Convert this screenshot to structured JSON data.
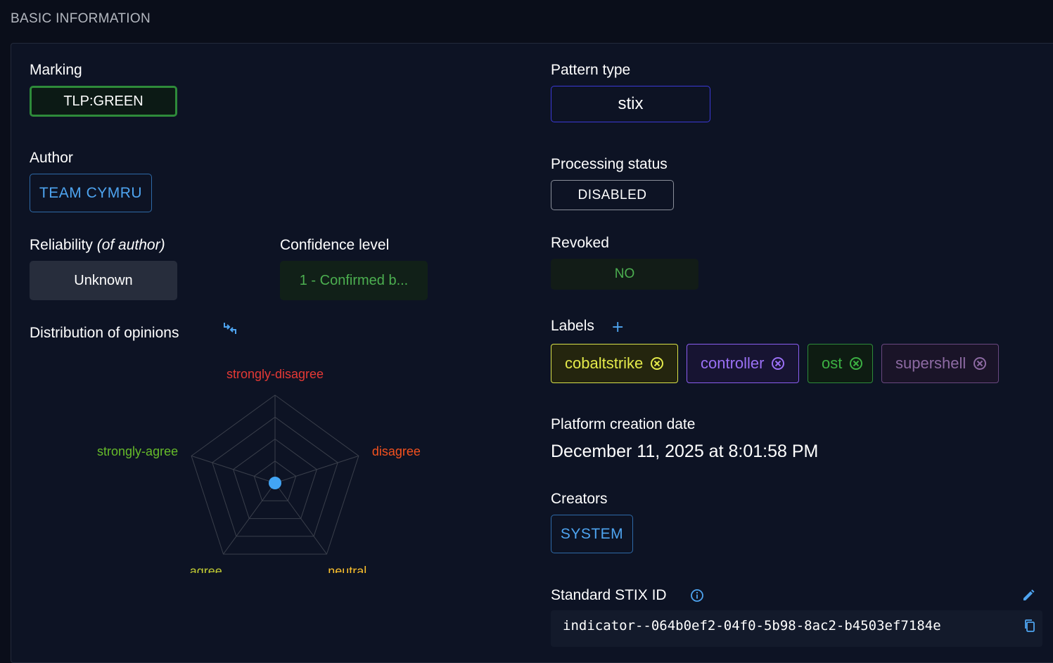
{
  "section_title": "BASIC INFORMATION",
  "marking": {
    "label": "Marking",
    "value": "TLP:GREEN"
  },
  "author": {
    "label": "Author",
    "value": "TEAM CYMRU"
  },
  "reliability": {
    "label": "Reliability",
    "label_suffix": "(of author)",
    "value": "Unknown"
  },
  "confidence": {
    "label": "Confidence level",
    "value": "1 - Confirmed b..."
  },
  "opinions": {
    "label": "Distribution of opinions",
    "axes": [
      "strongly-disagree",
      "disagree",
      "neutral",
      "agree",
      "strongly-agree"
    ],
    "colors": {
      "strongly-disagree": "#e53935",
      "disagree": "#f4511e",
      "neutral": "#fbc02d",
      "agree": "#c0ca33",
      "strongly-agree": "#66bb2a"
    },
    "point_color": "#42a5f5"
  },
  "pattern_type": {
    "label": "Pattern type",
    "value": "stix"
  },
  "processing_status": {
    "label": "Processing status",
    "value": "DISABLED"
  },
  "revoked": {
    "label": "Revoked",
    "value": "NO"
  },
  "labels": {
    "label": "Labels",
    "items": [
      "cobaltstrike",
      "controller",
      "ost",
      "supershell"
    ]
  },
  "platform_creation_date": {
    "label": "Platform creation date",
    "value": "December 11, 2025 at 8:01:58 PM"
  },
  "creators": {
    "label": "Creators",
    "value": "SYSTEM"
  },
  "stix_id": {
    "label": "Standard STIX ID",
    "value": "indicator--064b0ef2-04f0-5b98-8ac2-b4503ef7184e"
  }
}
